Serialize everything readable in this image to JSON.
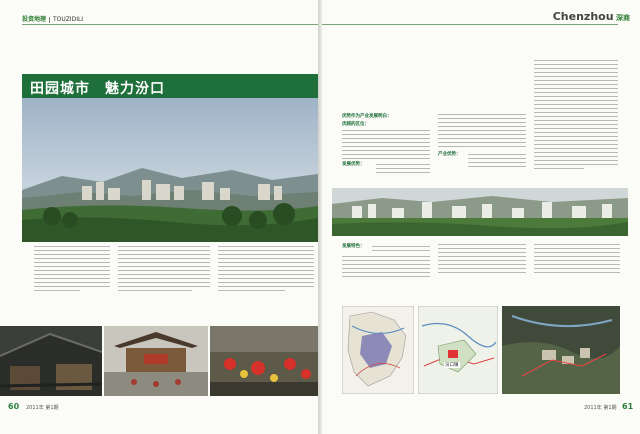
{
  "header": {
    "section_cn": "投资地理",
    "section_en": "TOUZIDILI",
    "brand_en": "Chenzhou",
    "brand_cn": "深商"
  },
  "article": {
    "title": "田园城市　魅力汾口"
  },
  "paragraphs": {
    "p1_label": "优势作为产业发展明白：",
    "p2_label": "发展优势：",
    "p3_label": "产业优势：",
    "p4_label": "发展特色：",
    "p5_label": "优越的区位："
  },
  "footer": {
    "left_page": "60",
    "right_page": "61",
    "issue_left": "2011年 第1期",
    "issue_right": "2011年 第1期"
  },
  "maps": {
    "map2_label": "汾口镇"
  },
  "colors": {
    "accent": "#1f6f3a",
    "title_band": "#1f6f3a"
  }
}
